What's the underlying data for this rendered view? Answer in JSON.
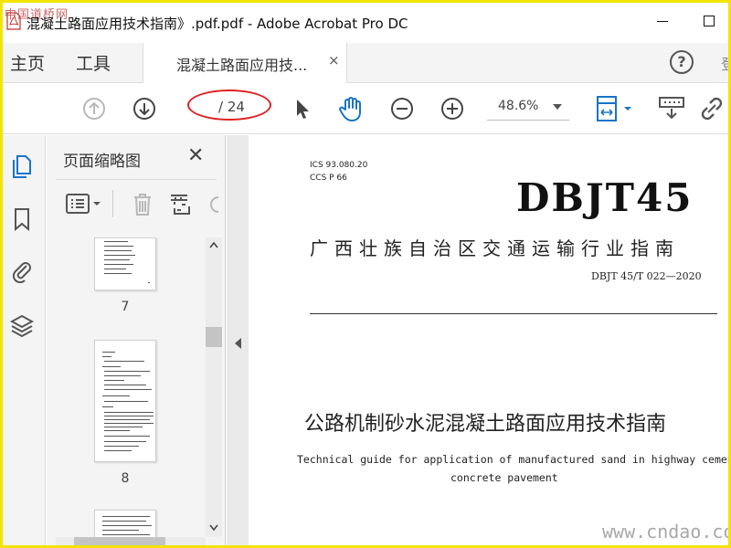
{
  "window": {
    "title": "混凝土路面应用技术指南》.pdf.pdf - Adobe Acrobat Pro DC",
    "watermark_top": "中国道桥网"
  },
  "menu": {
    "home": "主页",
    "tools": "工具",
    "tab_label": "混凝土路面应用技...",
    "tab_close": "×",
    "help": "?",
    "partial_right": "登"
  },
  "toolbar": {
    "page_current": "",
    "page_total": "/ 24",
    "zoom": "48.6%"
  },
  "panel": {
    "title": "页面缩略图",
    "close": "✕",
    "thumbnails": [
      {
        "label": "7"
      },
      {
        "label": "8"
      }
    ]
  },
  "document": {
    "ics": "ICS  93.080.20",
    "ccs": "CCS  P 66",
    "code": "DBJT45",
    "issuer": "广西壮族自治区交通运输行业指南",
    "number": "DBJT 45/T  022—2020",
    "title_cn": "公路机制砂水泥混凝土路面应用技术指南",
    "title_en_line1": "Technical guide for application of manufactured sand in highway cement",
    "title_en_line2": "concrete pavement"
  },
  "watermark_bottom": "www.cndao.com",
  "colors": {
    "frame": "#f2e400",
    "annotation": "#e02020",
    "accent": "#1a73c8"
  }
}
